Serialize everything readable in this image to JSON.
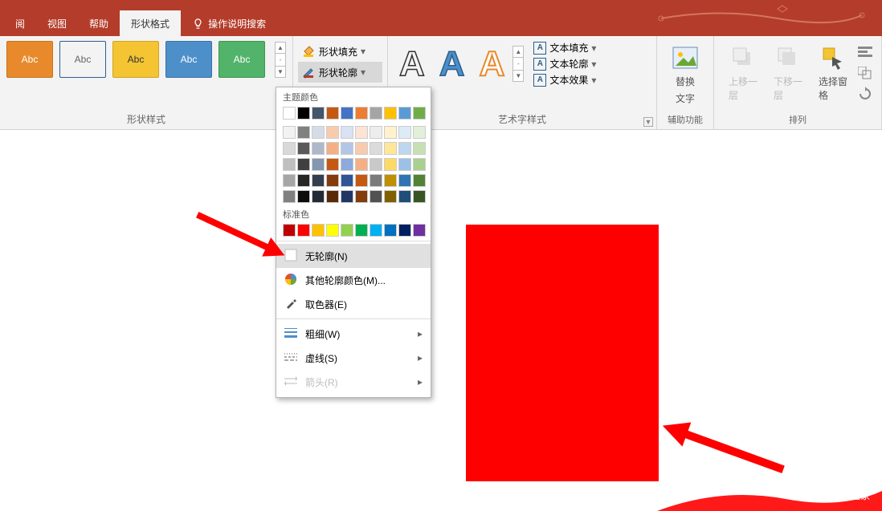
{
  "tabs": {
    "review": "阅",
    "view": "视图",
    "help": "帮助",
    "shapeFormat": "形状格式",
    "tellme": "操作说明搜索"
  },
  "ribbon": {
    "styleLabel": "Abc",
    "groupStyles": "形状样式",
    "shapeFill": "形状填充",
    "shapeOutline": "形状轮廓",
    "groupWordArt": "艺术字样式",
    "textFill": "文本填充",
    "textOutline": "文本轮廓",
    "textEffects": "文本效果",
    "altText1": "替换",
    "altText2": "文字",
    "groupAccess": "辅助功能",
    "bringForward": "上移一层",
    "sendBackward": "下移一层",
    "selectionPane": "选择窗格",
    "groupArrange": "排列"
  },
  "dropdown": {
    "themeColors": "主题颜色",
    "standardColors": "标准色",
    "noOutline": "无轮廓(N)",
    "moreColors": "其他轮廓颜色(M)...",
    "eyedropper": "取色器(E)",
    "weight": "粗细(W)",
    "dashes": "虚线(S)",
    "arrows": "箭头(R)"
  },
  "theme_rows": [
    [
      "#ffffff",
      "#000000",
      "#44546a",
      "#c65911",
      "#4472c4",
      "#ed7d31",
      "#a5a5a5",
      "#ffc000",
      "#5b9bd5",
      "#70ad47"
    ],
    [
      "#f2f2f2",
      "#808080",
      "#d6dce5",
      "#f8cbad",
      "#d9e1f2",
      "#fce4d6",
      "#ededed",
      "#fff2cc",
      "#ddebf7",
      "#e2efda"
    ],
    [
      "#d9d9d9",
      "#595959",
      "#adb9ca",
      "#f4b084",
      "#b4c6e7",
      "#f8cbad",
      "#dbdbdb",
      "#ffe699",
      "#bdd7ee",
      "#c6e0b4"
    ],
    [
      "#bfbfbf",
      "#404040",
      "#8497b0",
      "#c65911",
      "#8ea9db",
      "#f4b084",
      "#c9c9c9",
      "#ffd966",
      "#9bc2e6",
      "#a9d08e"
    ],
    [
      "#a6a6a6",
      "#262626",
      "#333f4f",
      "#833c0c",
      "#305496",
      "#c65911",
      "#7b7b7b",
      "#bf8f00",
      "#2f75b5",
      "#548235"
    ],
    [
      "#808080",
      "#0d0d0d",
      "#222b35",
      "#5a2a08",
      "#203764",
      "#833c0c",
      "#525252",
      "#806000",
      "#1f4e78",
      "#375623"
    ]
  ],
  "standard": [
    "#c00000",
    "#ff0000",
    "#ffc000",
    "#ffff00",
    "#92d050",
    "#00b050",
    "#00b0f0",
    "#0070c0",
    "#002060",
    "#7030a0"
  ],
  "watermark": "系统之家"
}
